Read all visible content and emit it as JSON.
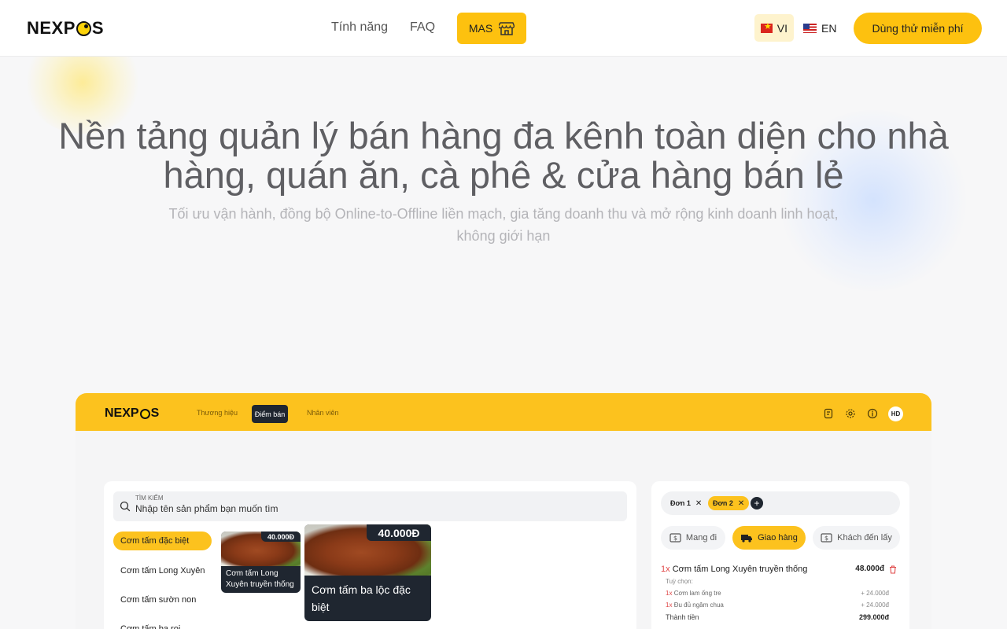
{
  "brand": {
    "logo_left": "NEXP",
    "logo_right": "S"
  },
  "nav": {
    "features": "Tính năng",
    "faq": "FAQ",
    "mas": "MAS",
    "lang_vi": "VI",
    "lang_en": "EN",
    "cta": "Dùng thử miễn phí"
  },
  "hero": {
    "title": "Nền tảng quản lý bán hàng đa kênh toàn diện cho nhà hàng, quán ăn, cà phê & cửa hàng bán lẻ",
    "subtitle": "Tối ưu vận hành, đồng bộ Online-to-Offline liền mạch, gia tăng doanh thu và mở rộng kinh doanh linh hoạt, không giới hạn"
  },
  "app": {
    "tabs": {
      "brand": "Thương hiệu",
      "pos": "Điểm bán",
      "staff": "Nhân viên"
    },
    "avatar": "HD",
    "search": {
      "label": "TÌM KIẾM",
      "placeholder": "Nhập tên sản phẩm bạn muốn tìm"
    },
    "categories": [
      "Cơm tấm đặc biệt",
      "Cơm tấm Long Xuyên",
      "Cơm tấm sườn non",
      "Cơm tấm ba rọi"
    ],
    "products": [
      {
        "name": "Cơm tấm Long Xuyên truyền thống",
        "price": "40.000Đ"
      },
      {
        "name": "Cơm tấm ba lộc đặc biệt",
        "price": "40.000Đ"
      }
    ],
    "orders": {
      "tab1": "Đơn 1",
      "tab2": "Đơn 2",
      "add": "+"
    },
    "modes": {
      "takeaway": "Mang đi",
      "delivery": "Giao hàng",
      "pickup": "Khách đến lấy"
    },
    "cart": {
      "qty": "1x",
      "item": "Cơm tấm Long Xuyên truyền thống",
      "item_price": "48.000đ",
      "options_label": "Tuỳ chọn:",
      "options": [
        {
          "qty": "1x",
          "name": "Cơm lam ống tre",
          "price": "+ 24.000đ"
        },
        {
          "qty": "1x",
          "name": "Đu đủ ngâm chua",
          "price": "+ 24.000đ"
        }
      ],
      "subtotal_label": "Thành tiền",
      "subtotal": "299.000đ"
    }
  },
  "colors": {
    "accent": "#fdc10f",
    "app_bar": "#fcc21e",
    "dark": "#1f2630"
  }
}
